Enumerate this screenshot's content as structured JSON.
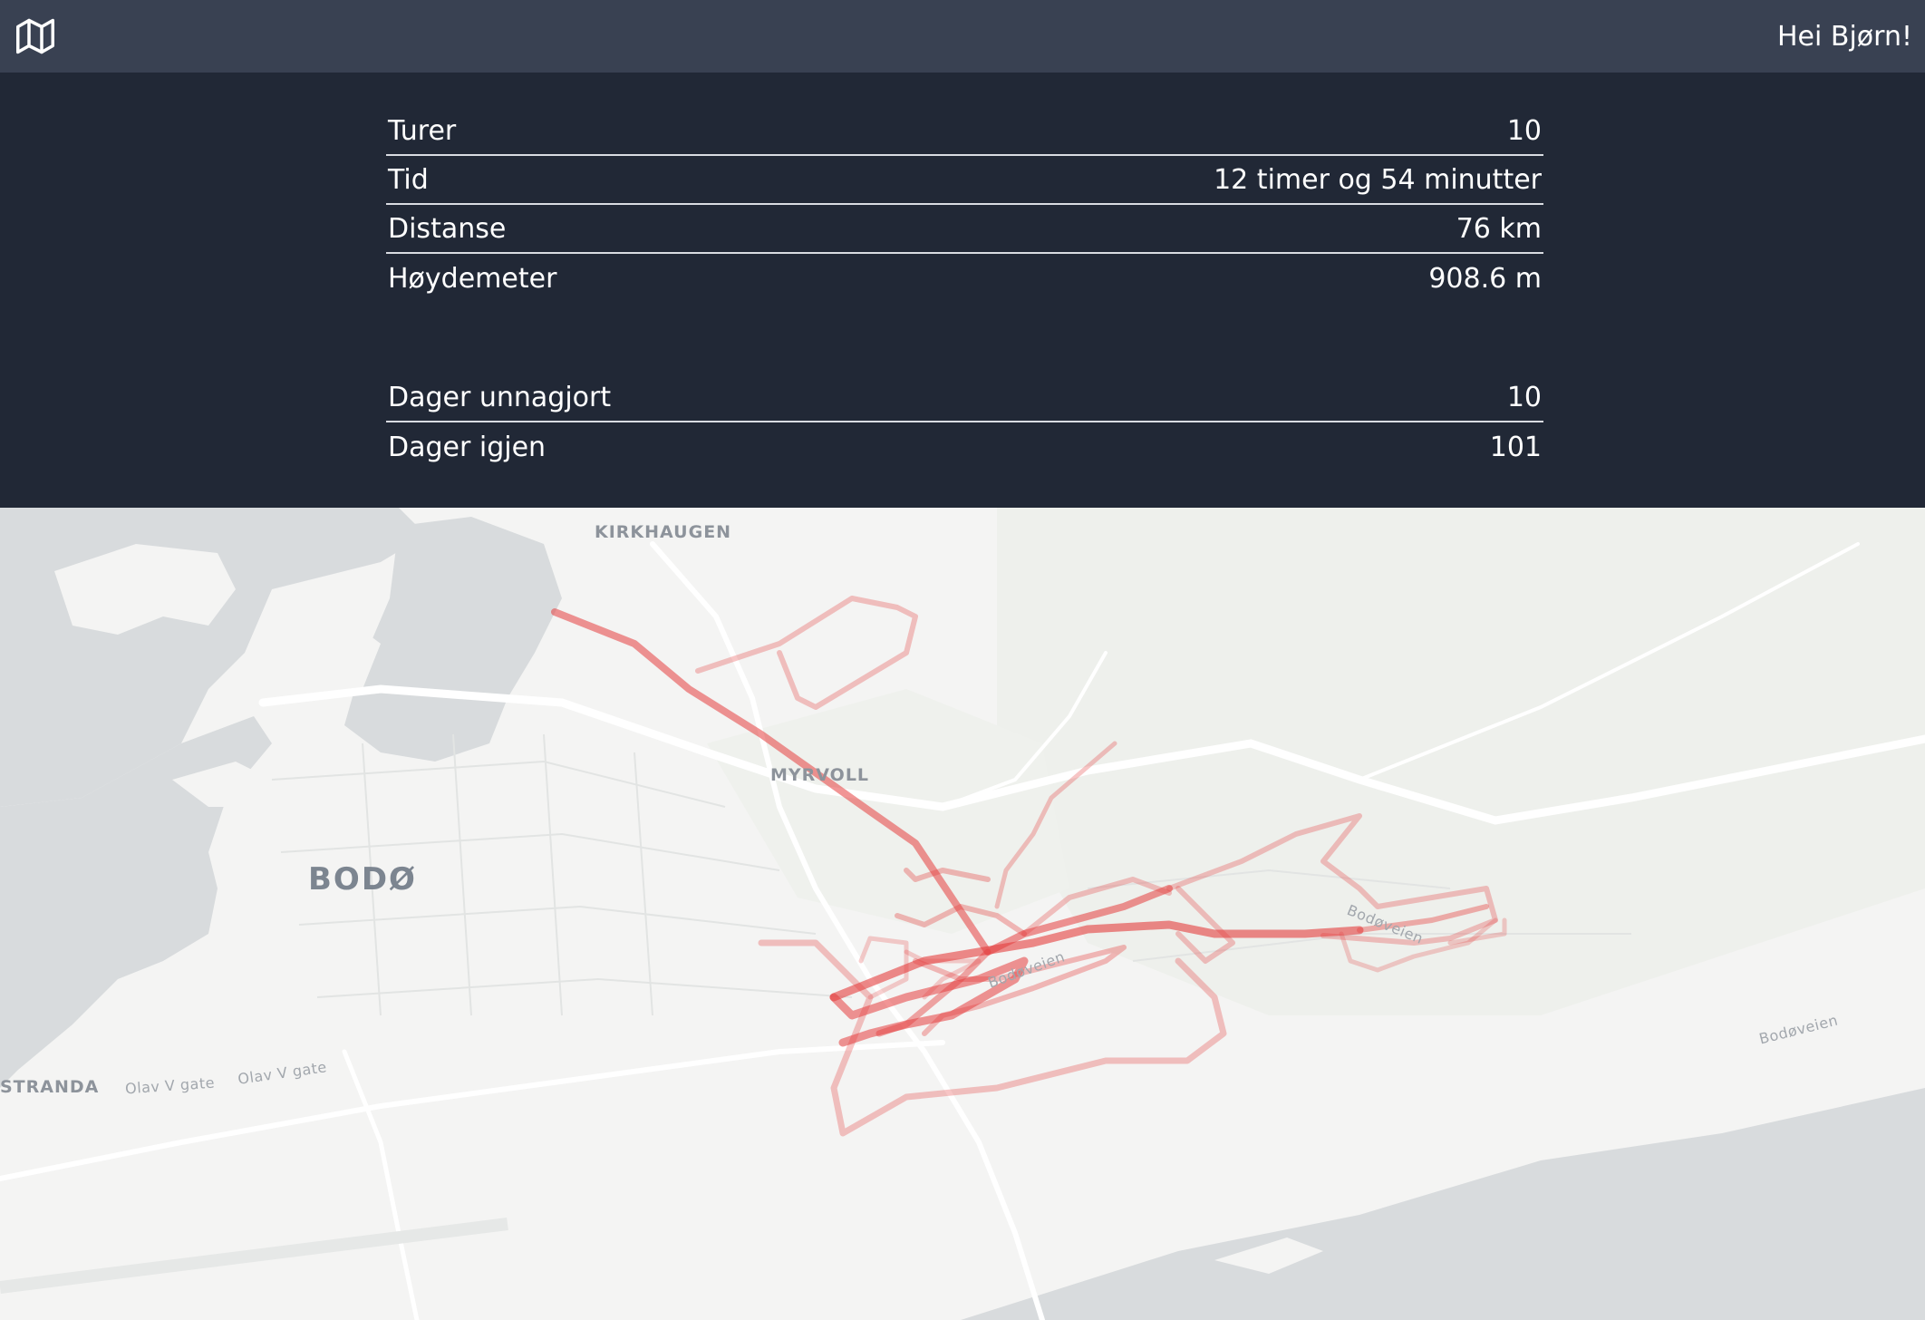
{
  "header": {
    "icon": "map-icon",
    "greeting": "Hei Bjørn!"
  },
  "stats": [
    {
      "label": "Turer",
      "value": "10"
    },
    {
      "label": "Tid",
      "value": "12 timer og 54 minutter"
    },
    {
      "label": "Distanse",
      "value": "76 km"
    },
    {
      "label": "Høydemeter",
      "value": "908.6 m"
    }
  ],
  "days": [
    {
      "label": "Dager unnagjort",
      "value": "10"
    },
    {
      "label": "Dager igjen",
      "value": "101"
    }
  ],
  "map": {
    "labels": {
      "kirkhaugen": "KIRKHAUGEN",
      "myrvoll": "MYRVOLL",
      "bodo": "BODØ",
      "strand": "STRANDA",
      "olav1": "Olav V gate",
      "olav2": "Olav V gate",
      "bodoveien1": "Bodøveien",
      "bodoveien2": "Bodøveien",
      "bodoveien3": "Bodøveien"
    },
    "track_color": "#e53e3e",
    "water_color": "#d8dbdd"
  }
}
